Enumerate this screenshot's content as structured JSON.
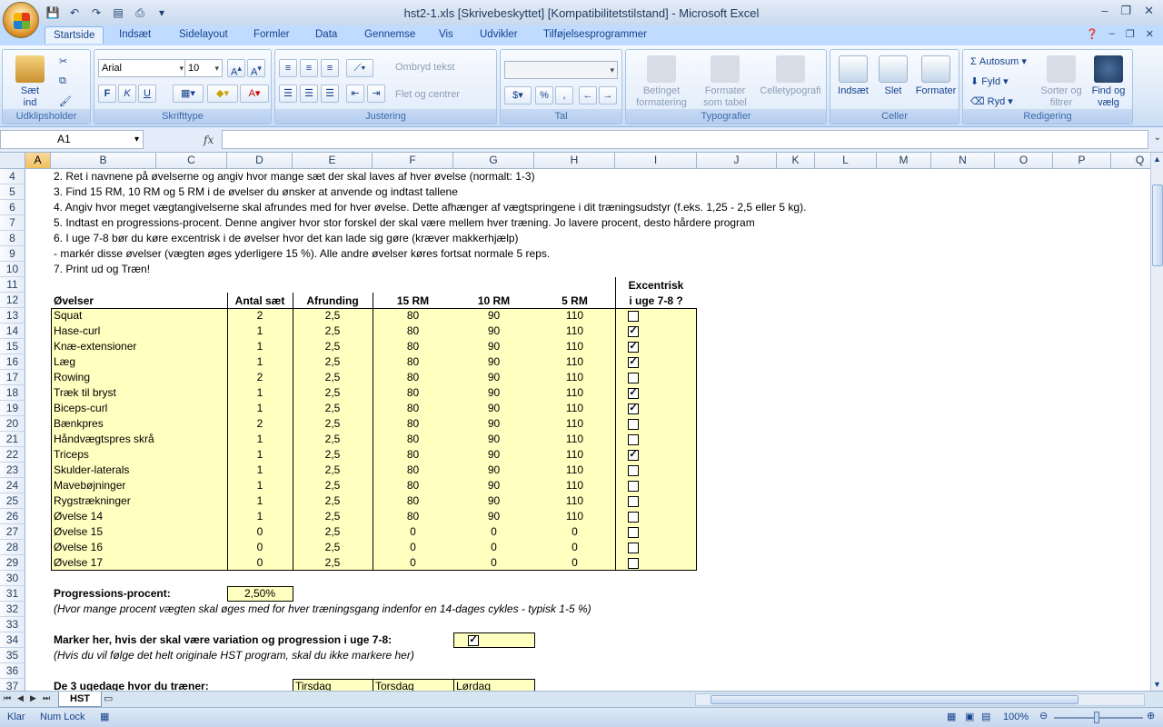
{
  "window": {
    "title": "hst2-1.xls  [Skrivebeskyttet]  [Kompatibilitetstilstand] - Microsoft Excel"
  },
  "tabs": [
    "Startside",
    "Indsæt",
    "Sidelayout",
    "Formler",
    "Data",
    "Gennemse",
    "Vis",
    "Udvikler",
    "Tilføjelsesprogrammer"
  ],
  "ribbon": {
    "clipboard": {
      "label": "Udklipsholder",
      "paste": "Sæt",
      "paste2": "ind"
    },
    "font": {
      "label": "Skrifttype",
      "name": "Arial",
      "size": "10"
    },
    "alignment": {
      "label": "Justering",
      "wrap": "Ombryd tekst",
      "merge": "Flet og centrer"
    },
    "number": {
      "label": "Tal"
    },
    "styles": {
      "label": "Typografier",
      "cond1": "Betinget",
      "cond2": "formatering",
      "table1": "Formater",
      "table2": "som tabel",
      "cell": "Celletypografi"
    },
    "cells": {
      "label": "Celler",
      "insert": "Indsæt",
      "delete": "Slet",
      "format": "Formater"
    },
    "editing": {
      "label": "Redigering",
      "autosum": "Autosum",
      "fill": "Fyld",
      "clear": "Ryd",
      "sort1": "Sorter og",
      "sort2": "filtrer",
      "find1": "Find og",
      "find2": "vælg"
    }
  },
  "formula": {
    "namebox": "A1",
    "fx": "fx"
  },
  "columns": [
    "A",
    "B",
    "C",
    "D",
    "E",
    "F",
    "G",
    "H",
    "I",
    "J",
    "K",
    "L",
    "M",
    "N",
    "O",
    "P",
    "Q"
  ],
  "rows": [
    "4",
    "5",
    "6",
    "7",
    "8",
    "9",
    "10",
    "11",
    "12",
    "13",
    "14",
    "15",
    "16",
    "17",
    "18",
    "19",
    "20",
    "21",
    "22",
    "23",
    "24",
    "25",
    "26",
    "27",
    "28",
    "29",
    "30",
    "31",
    "32",
    "33",
    "34",
    "35",
    "36",
    "37"
  ],
  "instructions": [
    "2. Ret i navnene på øvelserne og angiv hvor mange sæt der skal laves af hver øvelse (normalt: 1-3)",
    "3. Find 15 RM, 10 RM og 5 RM i de øvelser du ønsker at anvende og indtast tallene",
    "4.  Angiv hvor meget vægtangivelserne skal afrundes med for hver øvelse. Dette afhænger af vægtspringene i dit træningsudstyr (f.eks. 1,25 - 2,5 eller 5 kg).",
    "5. Indtast en progressions-procent. Denne angiver hvor stor forskel der skal være mellem hver træning. Jo lavere procent, desto hårdere program",
    "6. I uge 7-8 bør du køre excentrisk i de øvelser hvor det kan lade sig gøre (kræver makkerhjælp)",
    "   - markér disse øvelser (vægten øges yderligere 15 %). Alle andre øvelser køres fortsat normale 5 reps.",
    "7. Print ud og Træn!"
  ],
  "table": {
    "headers": {
      "exercise": "Øvelser",
      "sets": "Antal sæt",
      "rounding": "Afrunding",
      "rm15": "15 RM",
      "rm10": "10 RM",
      "rm5": "5 RM",
      "ecc1": "Excentrisk",
      "ecc2": "i uge 7-8 ?"
    },
    "rows": [
      {
        "name": "Squat",
        "sets": "2",
        "round": "2,5",
        "rm15": "80",
        "rm10": "90",
        "rm5": "110",
        "ecc": false
      },
      {
        "name": "Hase-curl",
        "sets": "1",
        "round": "2,5",
        "rm15": "80",
        "rm10": "90",
        "rm5": "110",
        "ecc": true
      },
      {
        "name": "Knæ-extensioner",
        "sets": "1",
        "round": "2,5",
        "rm15": "80",
        "rm10": "90",
        "rm5": "110",
        "ecc": true
      },
      {
        "name": "Læg",
        "sets": "1",
        "round": "2,5",
        "rm15": "80",
        "rm10": "90",
        "rm5": "110",
        "ecc": true
      },
      {
        "name": "Rowing",
        "sets": "2",
        "round": "2,5",
        "rm15": "80",
        "rm10": "90",
        "rm5": "110",
        "ecc": false
      },
      {
        "name": "Træk til bryst",
        "sets": "1",
        "round": "2,5",
        "rm15": "80",
        "rm10": "90",
        "rm5": "110",
        "ecc": true
      },
      {
        "name": "Biceps-curl",
        "sets": "1",
        "round": "2,5",
        "rm15": "80",
        "rm10": "90",
        "rm5": "110",
        "ecc": true
      },
      {
        "name": "Bænkpres",
        "sets": "2",
        "round": "2,5",
        "rm15": "80",
        "rm10": "90",
        "rm5": "110",
        "ecc": false
      },
      {
        "name": "Håndvægtspres skrå",
        "sets": "1",
        "round": "2,5",
        "rm15": "80",
        "rm10": "90",
        "rm5": "110",
        "ecc": false
      },
      {
        "name": "Triceps",
        "sets": "1",
        "round": "2,5",
        "rm15": "80",
        "rm10": "90",
        "rm5": "110",
        "ecc": true
      },
      {
        "name": "Skulder-laterals",
        "sets": "1",
        "round": "2,5",
        "rm15": "80",
        "rm10": "90",
        "rm5": "110",
        "ecc": false
      },
      {
        "name": "Mavebøjninger",
        "sets": "1",
        "round": "2,5",
        "rm15": "80",
        "rm10": "90",
        "rm5": "110",
        "ecc": false
      },
      {
        "name": "Rygstrækninger",
        "sets": "1",
        "round": "2,5",
        "rm15": "80",
        "rm10": "90",
        "rm5": "110",
        "ecc": false
      },
      {
        "name": "Øvelse 14",
        "sets": "1",
        "round": "2,5",
        "rm15": "80",
        "rm10": "90",
        "rm5": "110",
        "ecc": false
      },
      {
        "name": "Øvelse 15",
        "sets": "0",
        "round": "2,5",
        "rm15": "0",
        "rm10": "0",
        "rm5": "0",
        "ecc": false
      },
      {
        "name": "Øvelse 16",
        "sets": "0",
        "round": "2,5",
        "rm15": "0",
        "rm10": "0",
        "rm5": "0",
        "ecc": false
      },
      {
        "name": "Øvelse 17",
        "sets": "0",
        "round": "2,5",
        "rm15": "0",
        "rm10": "0",
        "rm5": "0",
        "ecc": false
      }
    ]
  },
  "progression": {
    "label": "Progressions-procent:",
    "value": "2,50%",
    "note": "(Hvor mange procent vægten skal øges med for hver træningsgang indenfor en 14-dages cykles - typisk 1-5 %)"
  },
  "variation": {
    "label": "Marker her, hvis der skal være variation og progression i uge 7-8:",
    "checked": true,
    "note": "(Hvis du vil følge det helt originale HST program, skal du ikke markere her)"
  },
  "days": {
    "label": "De 3 ugedage hvor du træner:",
    "values": [
      "Tirsdag",
      "Torsdag",
      "Lørdag"
    ]
  },
  "sheet": {
    "tab": "HST"
  },
  "status": {
    "mode": "Klar",
    "numlock": "Num Lock",
    "zoom": "100%"
  }
}
